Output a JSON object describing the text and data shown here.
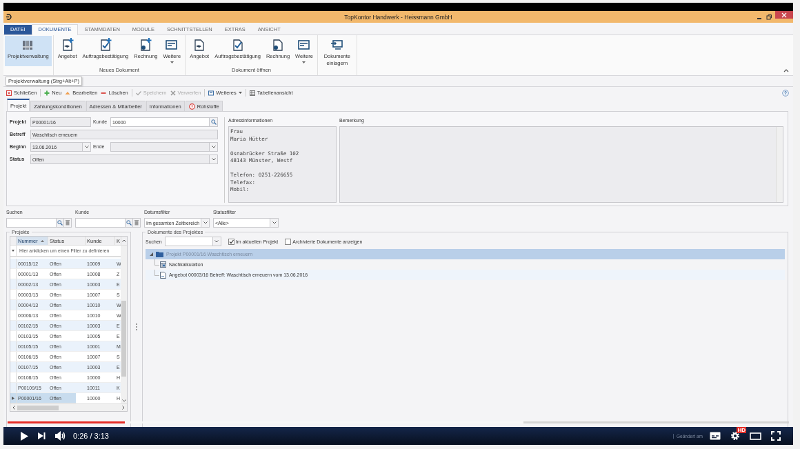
{
  "window": {
    "title": "TopKontor Handwerk  -  Heissmann GmbH"
  },
  "menu": [
    {
      "label": "DATEI",
      "kind": "file",
      "selected": false
    },
    {
      "label": "DOKUMENTE",
      "kind": "tab",
      "selected": true
    },
    {
      "label": "STAMMDATEN",
      "kind": "tab",
      "selected": false
    },
    {
      "label": "MODULE",
      "kind": "tab",
      "selected": false
    },
    {
      "label": "SCHNITTSTELLEN",
      "kind": "tab",
      "selected": false
    },
    {
      "label": "EXTRAS",
      "kind": "tab",
      "selected": false
    },
    {
      "label": "ANSICHT",
      "kind": "tab",
      "selected": false
    }
  ],
  "ribbon": {
    "groups": [
      {
        "buttons": [
          {
            "label": "Projektverwaltung",
            "kind": "binders",
            "new": false,
            "dropdown": false,
            "selected": true
          }
        ]
      },
      {
        "label": "Neues Dokument",
        "buttons": [
          {
            "label": "Angebot",
            "kind": "offer",
            "new": true,
            "dropdown": false,
            "selected": false
          },
          {
            "label": "Auftragsbestätigung",
            "kind": "order",
            "new": true,
            "dropdown": false,
            "selected": false
          },
          {
            "label": "Rechnung",
            "kind": "invoice",
            "new": true,
            "dropdown": false,
            "selected": false
          },
          {
            "label": "Weitere",
            "kind": "list",
            "new": false,
            "dropdown": true,
            "selected": false
          }
        ]
      },
      {
        "label": "Dokument öffnen",
        "buttons": [
          {
            "label": "Angebot",
            "kind": "offer",
            "new": false,
            "dropdown": false,
            "selected": false
          },
          {
            "label": "Auftragsbestätigung",
            "kind": "order",
            "new": false,
            "dropdown": false,
            "selected": false
          },
          {
            "label": "Rechnung",
            "kind": "invoice",
            "new": false,
            "dropdown": false,
            "selected": false
          },
          {
            "label": "Weitere",
            "kind": "list",
            "new": false,
            "dropdown": true,
            "selected": false
          }
        ]
      },
      {
        "buttons": [
          {
            "label": "Dokumente einlagern",
            "kind": "monitor",
            "new": false,
            "dropdown": false,
            "selected": false
          }
        ]
      }
    ]
  },
  "tooltip": "Projektverwaltung (Strg+Alt+P)",
  "toolbar": {
    "groups": [
      {
        "items": [
          {
            "label": "Schließen",
            "kind": "close",
            "disabled": false,
            "dropdown": false
          }
        ]
      },
      {
        "items": [
          {
            "label": "Neu",
            "kind": "plus",
            "disabled": false,
            "dropdown": false
          },
          {
            "label": "Bearbeiten",
            "kind": "edit",
            "disabled": false,
            "dropdown": false
          },
          {
            "label": "Löschen",
            "kind": "minus",
            "disabled": false,
            "dropdown": false
          }
        ]
      },
      {
        "items": [
          {
            "label": "Speichern",
            "kind": "check",
            "disabled": true,
            "dropdown": false
          },
          {
            "label": "Verwerfen",
            "kind": "cross",
            "disabled": true,
            "dropdown": false
          }
        ]
      },
      {
        "items": [
          {
            "label": "Weiteres",
            "kind": "list",
            "disabled": false,
            "dropdown": true
          }
        ]
      },
      {
        "items": [
          {
            "label": "Tabellenansicht",
            "kind": "table",
            "disabled": false,
            "dropdown": false
          }
        ]
      }
    ]
  },
  "tabs": [
    {
      "label": "Projekt",
      "selected": true,
      "warning": false
    },
    {
      "label": "Zahlungskonditionen",
      "selected": false,
      "warning": false
    },
    {
      "label": "Adressen & Mitarbeiter",
      "selected": false,
      "warning": false
    },
    {
      "label": "Informationen",
      "selected": false,
      "warning": false
    },
    {
      "label": "Rohstoffe",
      "selected": false,
      "warning": true
    }
  ],
  "form": {
    "projekt": {
      "label": "Projekt",
      "value": "P00001/16"
    },
    "kunde": {
      "label": "Kunde",
      "value": "10000"
    },
    "betreff": {
      "label": "Betreff",
      "value": "Waschtisch erneuern"
    },
    "beginn": {
      "label": "Beginn",
      "value": "13.06.2016"
    },
    "ende": {
      "label": "Ende"
    },
    "status": {
      "label": "Status",
      "value": "Offen"
    }
  },
  "address": {
    "label": "Adressinformationen",
    "blocks": [
      {
        "lines": [
          "Frau",
          "Maria Hütter"
        ]
      },
      {
        "lines": [
          "Osnabrücker Straße 102",
          "48143 Münster, Westf"
        ]
      },
      {
        "lines": [
          "Telefon: 0251-226655",
          "Telefax:",
          "Mobil:"
        ]
      }
    ]
  },
  "remark": {
    "label": "Bemerkung"
  },
  "filters": [
    {
      "label": "Suchen",
      "kind": "search"
    },
    {
      "label": "Kunde",
      "kind": "search"
    },
    {
      "label": "Datumsfilter",
      "kind": "select",
      "value": "Im gesamten Zeitbereich"
    },
    {
      "label": "Statusfilter",
      "kind": "select",
      "value": "<Alle>"
    }
  ],
  "projects": {
    "title": "Projekte",
    "columns": [
      {
        "label": "Nummer",
        "sorted": true
      },
      {
        "label": "Status",
        "sorted": false
      },
      {
        "label": "Kunde",
        "sorted": false
      },
      {
        "label": "K",
        "sorted": false
      }
    ],
    "filter_hint": "Hier anklicken um einen Filter zu definieren",
    "rows": [
      {
        "cells": [
          "00015/12",
          "Offen",
          "10009",
          "W"
        ],
        "selected": false
      },
      {
        "cells": [
          "00001/13",
          "Offen",
          "10008",
          "Z"
        ],
        "selected": false
      },
      {
        "cells": [
          "00002/13",
          "Offen",
          "10003",
          "E"
        ],
        "selected": false
      },
      {
        "cells": [
          "00003/13",
          "Offen",
          "10007",
          "S"
        ],
        "selected": false
      },
      {
        "cells": [
          "00004/13",
          "Offen",
          "10010",
          "W"
        ],
        "selected": false
      },
      {
        "cells": [
          "00006/13",
          "Offen",
          "10010",
          "W"
        ],
        "selected": false
      },
      {
        "cells": [
          "00102/15",
          "Offen",
          "10003",
          "E"
        ],
        "selected": false
      },
      {
        "cells": [
          "00103/15",
          "Offen",
          "10005",
          "E"
        ],
        "selected": false
      },
      {
        "cells": [
          "00105/15",
          "Offen",
          "10001",
          "M"
        ],
        "selected": false
      },
      {
        "cells": [
          "00106/15",
          "Offen",
          "10007",
          "S"
        ],
        "selected": false
      },
      {
        "cells": [
          "00107/15",
          "Offen",
          "10003",
          "E"
        ],
        "selected": false
      },
      {
        "cells": [
          "00108/15",
          "Offen",
          "10000",
          "H"
        ],
        "selected": false
      },
      {
        "cells": [
          "P00109/15",
          "Offen",
          "10011",
          "K"
        ],
        "selected": false
      },
      {
        "cells": [
          "P00001/16",
          "Offen",
          "10000",
          "H"
        ],
        "selected": true
      }
    ]
  },
  "documents": {
    "title": "Dokumente des Projektes",
    "search_label": "Suchen",
    "options": [
      {
        "label": "Im aktuellen Projekt",
        "checked": true
      },
      {
        "label": "Archivierte Dokumente anzeigen",
        "checked": false
      }
    ],
    "tree": [
      {
        "label": "Projekt P00001/16 Waschtisch erneuern",
        "kind": "folder",
        "selected": true,
        "expanded": true,
        "children": [
          {
            "label": "Nachkalkulation",
            "kind": "calc",
            "selected": false
          },
          {
            "label": "Angebot 00003/16 Betreff: Waschtisch erneuern vom 13.06.2016",
            "kind": "doc",
            "selected": false
          }
        ]
      }
    ]
  },
  "status_bar": {
    "text": "Geändert am"
  },
  "player": {
    "level": 0.15,
    "time": "0:26 / 3:13",
    "badge": "HD"
  }
}
